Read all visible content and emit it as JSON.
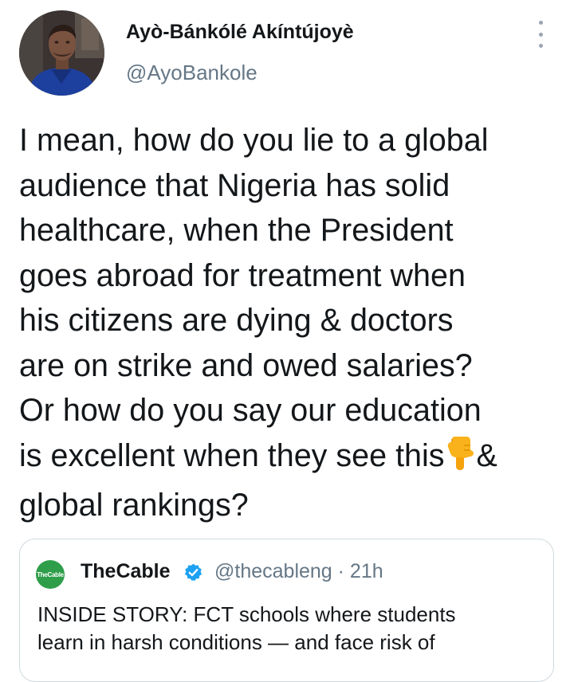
{
  "author": {
    "display_name": "Ayò-Bánkólé Akíntújoyè",
    "handle": "@AyoBankole"
  },
  "tweet": {
    "lines": [
      "I mean, how do you lie to a global",
      "audience that Nigeria has solid",
      "healthcare, when the President",
      "goes abroad for treatment when",
      "his citizens are dying & doctors",
      "are on strike and owed salaries?",
      "Or how do you say our education",
      "is excellent when they see this",
      "&",
      "global rankings?"
    ],
    "emoji": "backhand-index-pointing-down"
  },
  "quoted_tweet": {
    "logo_text": "TheCable",
    "name": "TheCable",
    "verified": true,
    "handle": "@thecableng",
    "separator": "·",
    "time": "21h",
    "handle_line": "@thecableng · 21h",
    "lines": [
      "INSIDE STORY: FCT schools where students",
      "learn in harsh conditions — and face risk of"
    ]
  },
  "colors": {
    "text": "#14171a",
    "secondary": "#657786",
    "verified": "#1da1f2",
    "cable_green": "#2f9e4a",
    "border": "#cfd9de"
  }
}
